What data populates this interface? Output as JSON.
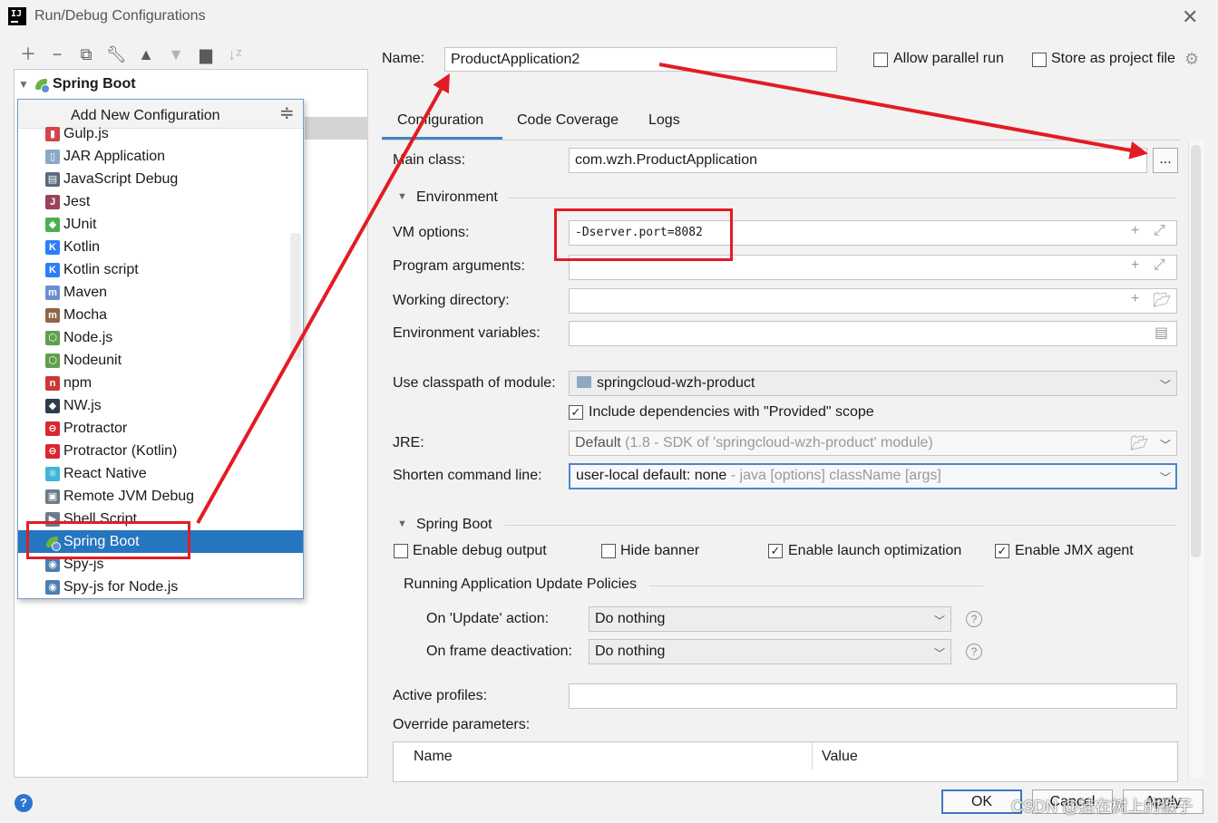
{
  "window": {
    "title": "Run/Debug Configurations",
    "app_icon": "IJ"
  },
  "toolbar": {
    "icons": [
      "plus-icon",
      "minus-icon",
      "copy-icon",
      "wrench-icon",
      "arrow-up-icon",
      "arrow-down-icon",
      "folder-add-icon",
      "sort-az-icon"
    ]
  },
  "tree": {
    "root_label": "Spring Boot"
  },
  "popup": {
    "title": "Add New Configuration",
    "items": [
      {
        "label": "Gulp.js",
        "icon": "gulp-icon",
        "color": "#cf4647"
      },
      {
        "label": "JAR Application",
        "icon": "jar-icon",
        "color": "#8aa8c8"
      },
      {
        "label": "JavaScript Debug",
        "icon": "js-debug-icon",
        "color": "#5a6a7a"
      },
      {
        "label": "Jest",
        "icon": "jest-icon",
        "color": "#99425b"
      },
      {
        "label": "JUnit",
        "icon": "junit-icon",
        "color": "#4caf50"
      },
      {
        "label": "Kotlin",
        "icon": "kotlin-icon",
        "color": "#2d7ff9"
      },
      {
        "label": "Kotlin script",
        "icon": "kotlin-script-icon",
        "color": "#2d7ff9"
      },
      {
        "label": "Maven",
        "icon": "maven-icon",
        "color": "#6a8fd0"
      },
      {
        "label": "Mocha",
        "icon": "mocha-icon",
        "color": "#8d6748"
      },
      {
        "label": "Node.js",
        "icon": "nodejs-icon",
        "color": "#5fa04e"
      },
      {
        "label": "Nodeunit",
        "icon": "nodeunit-icon",
        "color": "#5fa04e"
      },
      {
        "label": "npm",
        "icon": "npm-icon",
        "color": "#cb3837"
      },
      {
        "label": "NW.js",
        "icon": "nwjs-icon",
        "color": "#2f3b4a"
      },
      {
        "label": "Protractor",
        "icon": "protractor-icon",
        "color": "#d7282f"
      },
      {
        "label": "Protractor (Kotlin)",
        "icon": "protractor-kotlin-icon",
        "color": "#d7282f"
      },
      {
        "label": "React Native",
        "icon": "react-icon",
        "color": "#3fb6d6"
      },
      {
        "label": "Remote JVM Debug",
        "icon": "remote-debug-icon",
        "color": "#6d7a88"
      },
      {
        "label": "Shell Script",
        "icon": "shell-icon",
        "color": "#6d7a88"
      },
      {
        "label": "Spring Boot",
        "icon": "spring-boot-icon",
        "color": "#6db33f"
      },
      {
        "label": "Spy-js",
        "icon": "spyjs-icon",
        "color": "#4a7fb0"
      },
      {
        "label": "Spy-js for Node.js",
        "icon": "spyjs-node-icon",
        "color": "#4a7fb0"
      }
    ],
    "selected_label": "Spring Boot"
  },
  "form": {
    "name_label": "Name:",
    "name_value": "ProductApplication2",
    "allow_parallel_label": "Allow parallel run",
    "store_project_label": "Store as project file",
    "tabs": [
      "Configuration",
      "Code Coverage",
      "Logs"
    ],
    "active_tab": "Configuration",
    "main_class_label": "Main class:",
    "main_class_value": "com.wzh.ProductApplication",
    "browse_label": "...",
    "environment_section": "Environment",
    "vm_options_label": "VM options:",
    "vm_options_value": "-Dserver.port=8082",
    "program_args_label": "Program arguments:",
    "working_dir_label": "Working directory:",
    "env_vars_label": "Environment variables:",
    "classpath_label": "Use classpath of module:",
    "classpath_value": "springcloud-wzh-product",
    "include_deps_label": "Include dependencies with \"Provided\" scope",
    "jre_label": "JRE:",
    "jre_value": "Default",
    "jre_hint": "(1.8 - SDK of 'springcloud-wzh-product' module)",
    "shorten_label": "Shorten command line:",
    "shorten_value": "user-local default: none",
    "shorten_hint": "- java [options] className [args]",
    "spring_boot_section": "Spring Boot",
    "enable_debug_label": "Enable debug output",
    "hide_banner_label": "Hide banner",
    "launch_opt_label": "Enable launch optimization",
    "jmx_label": "Enable JMX agent",
    "update_policies_label": "Running Application Update Policies",
    "on_update_label": "On 'Update' action:",
    "on_update_value": "Do nothing",
    "on_frame_label": "On frame deactivation:",
    "on_frame_value": "Do nothing",
    "active_profiles_label": "Active profiles:",
    "override_label": "Override parameters:",
    "col_name": "Name",
    "col_value": "Value"
  },
  "checkboxes": {
    "allow_parallel": false,
    "store_project": false,
    "include_deps": true,
    "enable_debug": false,
    "hide_banner": false,
    "launch_opt": true,
    "jmx": true
  },
  "buttons": {
    "ok": "OK",
    "cancel": "Cancel",
    "apply": "Apply"
  },
  "watermark": "CSDN @挂在树上的猴子",
  "colors": {
    "selection": "#2675bf",
    "annotation": "#e21c24",
    "tab_accent": "#4083c9"
  }
}
